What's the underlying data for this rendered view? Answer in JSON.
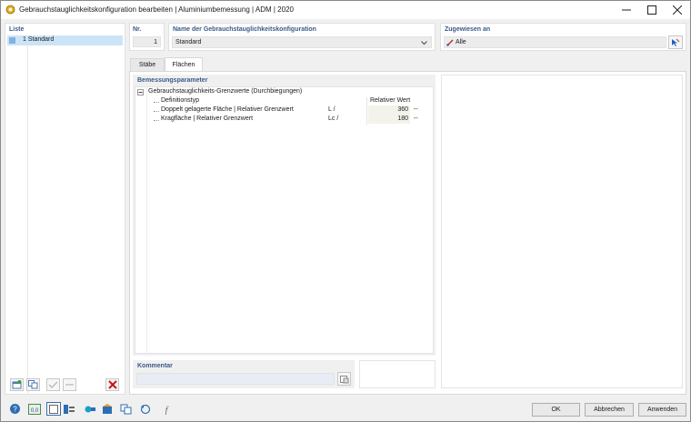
{
  "window": {
    "title": "Gebrauchstauglichkeitskonfiguration bearbeiten | Aluminiumbemessung | ADM | 2020"
  },
  "list": {
    "header": "Liste",
    "items": [
      {
        "label": "1  Standard"
      }
    ]
  },
  "nr": {
    "header": "Nr.",
    "value": "1"
  },
  "name": {
    "header": "Name der Gebrauchstauglichkeitskonfiguration",
    "value": "Standard"
  },
  "assigned": {
    "header": "Zugewiesen an",
    "value": "Alle"
  },
  "tabs": [
    {
      "label": "Stäbe"
    },
    {
      "label": "Flächen"
    }
  ],
  "params": {
    "header": "Bemessungsparameter",
    "group": "Gebrauchstauglichkeits-Grenzwerte (Durchbiegungen)",
    "rows": [
      {
        "label": "Definitionstyp",
        "symbol": "",
        "value": "Relativer Wert",
        "unit": ""
      },
      {
        "label": "Doppelt gelagerte Fläche | Relativer Grenzwert",
        "symbol": "L /",
        "value": "360",
        "unit": "--"
      },
      {
        "label": "Kragfläche | Relativer Grenzwert",
        "symbol": "Lc /",
        "value": "180",
        "unit": "--"
      }
    ]
  },
  "comment": {
    "header": "Kommentar",
    "value": ""
  },
  "buttons": {
    "ok": "OK",
    "cancel": "Abbrechen",
    "apply": "Anwenden"
  },
  "colors": {
    "header_blue": "#3a5a8a",
    "selection": "#cce4f7",
    "delete_red": "#d01010"
  }
}
